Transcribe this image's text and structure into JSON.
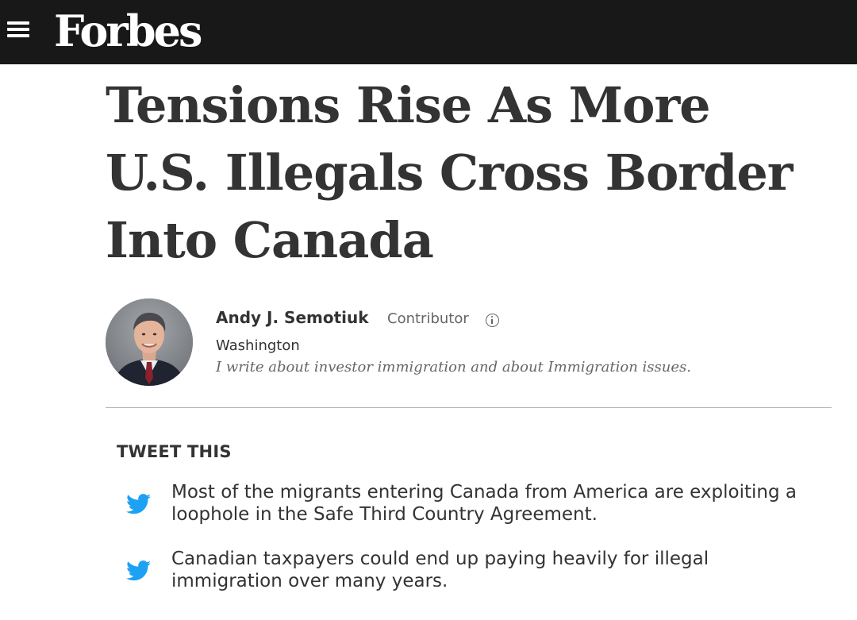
{
  "header": {
    "menu_icon": "hamburger-menu-icon",
    "logo_text": "Forbes",
    "background_color": "#181818"
  },
  "article": {
    "headline": "Tensions Rise As More U.S. Illegals Cross Border Into Canada"
  },
  "author": {
    "name": "Andy J. Semotiuk",
    "role": "Contributor",
    "role_icon": "info-icon",
    "location": "Washington",
    "bio": "I write about investor immigration and about Immigration issues."
  },
  "tweet_this": {
    "heading": "TWEET THIS",
    "icon": "twitter-bird-icon",
    "icon_color": "#1da1f2",
    "items": [
      {
        "text": "Most of the migrants entering Canada from America are exploiting a loophole in the Safe Third Country Agreement."
      },
      {
        "text": "Canadian taxpayers could end up paying heavily for illegal immigration over many years."
      }
    ]
  }
}
